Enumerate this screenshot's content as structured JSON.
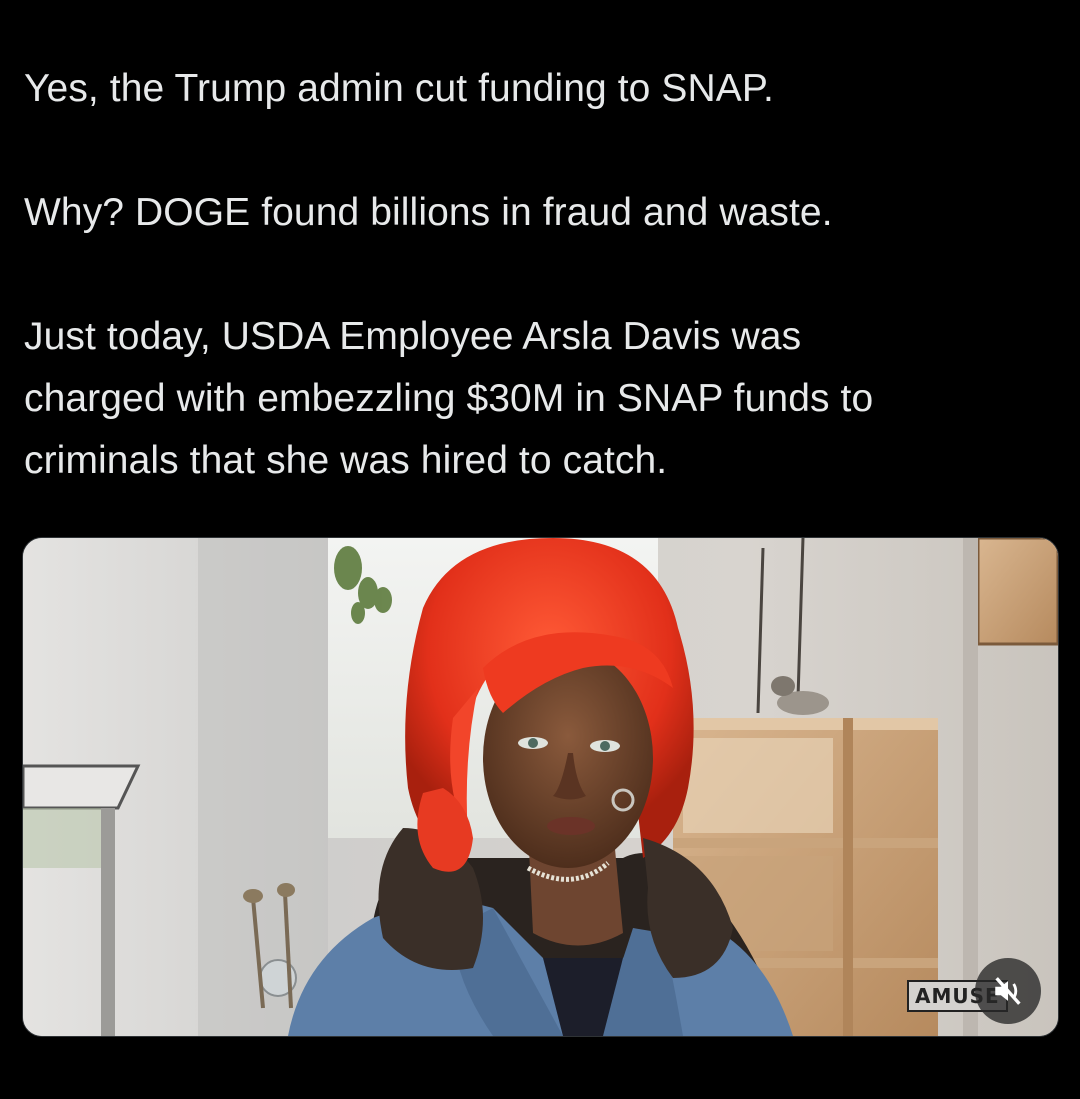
{
  "post": {
    "line1": "Yes, the Trump admin cut funding to SNAP.",
    "line2": "Why? DOGE found billions in fraud and waste.",
    "line3a": "Just today,  USDA Employee Arsla Davis was",
    "line3b": "charged with embezzling $30M in SNAP funds to",
    "line3c": "criminals that she was hired to catch."
  },
  "media": {
    "watermark": "AMUSE",
    "mute_icon": "speaker-muted-icon",
    "accent_hair": "#e8321c"
  }
}
